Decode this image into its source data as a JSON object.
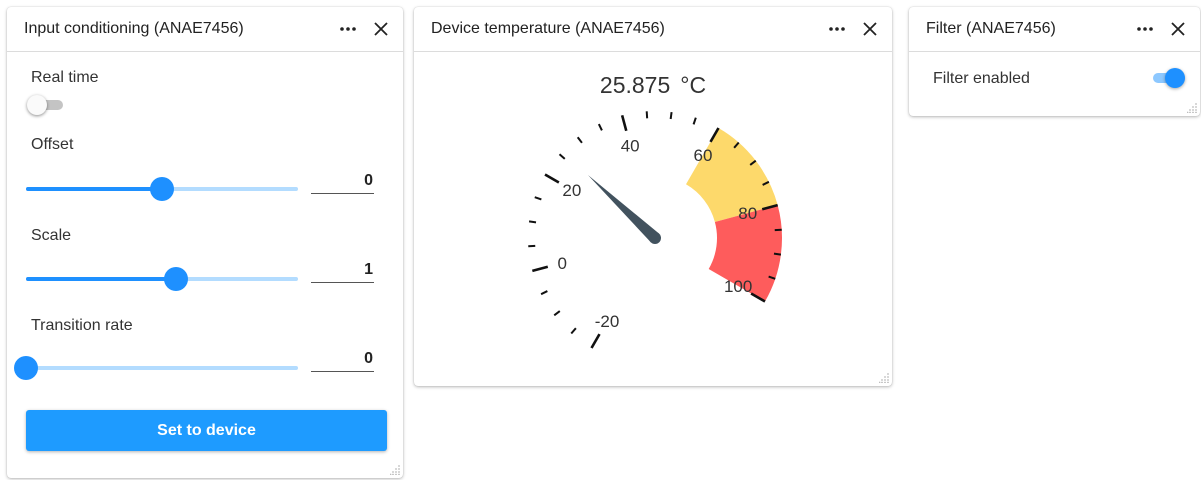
{
  "colors": {
    "accent": "#1e90ff",
    "accent_light": "#b3dcff",
    "button": "#1e9bff",
    "gauge_warning": "#fdd96b",
    "gauge_danger": "#fe5c5c",
    "needle": "#42525e"
  },
  "icons": {
    "more": "more-horizontal-icon",
    "close": "close-icon",
    "resize": "resize-grip-icon"
  },
  "input_conditioning": {
    "title": "Input conditioning (ANAE7456)",
    "real_time_label": "Real time",
    "real_time_on": false,
    "offset_label": "Offset",
    "offset_value": "0",
    "offset_fraction": 0.5,
    "scale_label": "Scale",
    "scale_value": "1",
    "scale_fraction": 0.55,
    "transition_label": "Transition rate",
    "transition_value": "0",
    "transition_fraction": 0.0,
    "set_button": "Set to device"
  },
  "temperature": {
    "title": "Device temperature (ANAE7456)",
    "value": "25.875",
    "unit": "°C",
    "reading": 25.875,
    "min": -20,
    "max": 100,
    "tick_labels": [
      "-20",
      "0",
      "20",
      "40",
      "60",
      "80",
      "100"
    ],
    "warning_band": [
      60,
      80
    ],
    "danger_band": [
      80,
      100
    ]
  },
  "filter": {
    "title": "Filter (ANAE7456)",
    "enabled_label": "Filter enabled",
    "enabled": true
  }
}
